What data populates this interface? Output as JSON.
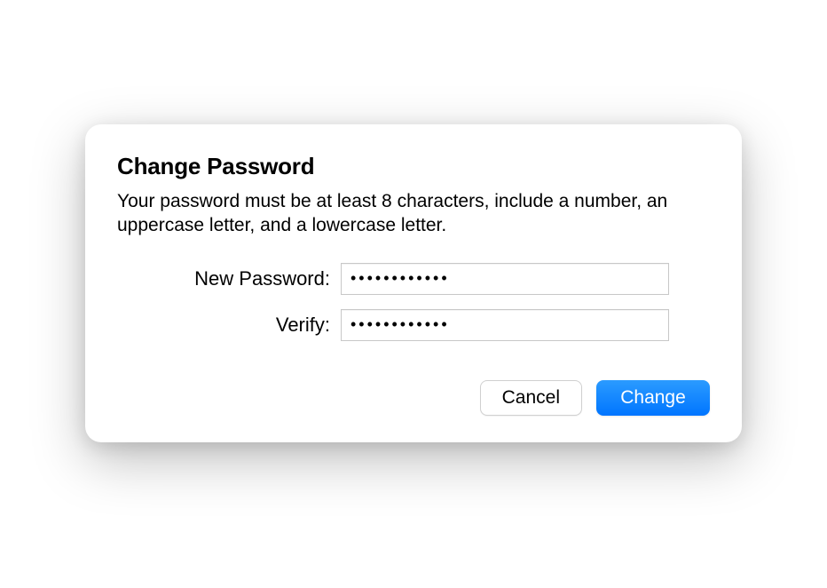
{
  "dialog": {
    "title": "Change Password",
    "description": "Your password must be at least 8 characters, include a number, an uppercase letter, and a lowercase letter.",
    "fields": {
      "new_password": {
        "label": "New Password:",
        "value": "●●●●●●●●●●●●"
      },
      "verify": {
        "label": "Verify:",
        "value": "●●●●●●●●●●●●"
      }
    },
    "buttons": {
      "cancel": "Cancel",
      "confirm": "Change"
    }
  }
}
